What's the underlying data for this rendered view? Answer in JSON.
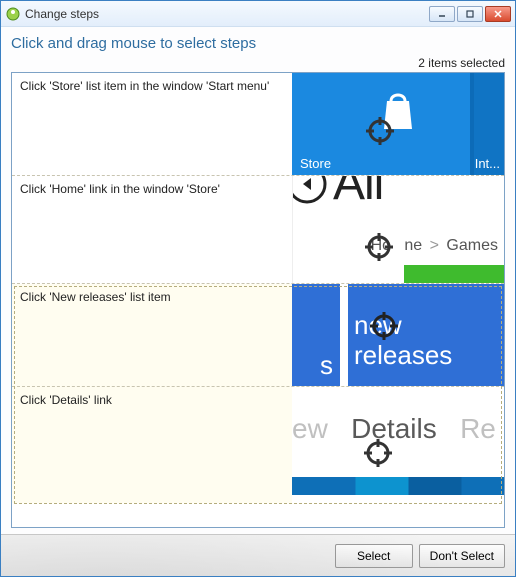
{
  "window": {
    "title": "Change steps"
  },
  "instruction": "Click and drag mouse to select steps",
  "selection_count_text": "2 items selected",
  "steps": [
    {
      "desc": "Click 'Store' list item in the window 'Start menu'",
      "selected": false,
      "thumb": {
        "store_label": "Store",
        "store_label2": "Int..."
      }
    },
    {
      "desc": "Click 'Home' link in the window 'Store'",
      "selected": false,
      "thumb": {
        "big_text": "All",
        "crumb_home": "Ho",
        "crumb_ne": "ne",
        "crumb_sep": ">",
        "crumb_games": "Games"
      }
    },
    {
      "desc": "Click 'New releases' list item",
      "selected": true,
      "thumb": {
        "tile_left_frag": "s",
        "tile_right_line1": "new",
        "tile_right_line2": "releases"
      }
    },
    {
      "desc": "Click 'Details' link",
      "selected": true,
      "thumb": {
        "left_frag": "ew",
        "mid": "Details",
        "right_frag": "Re"
      }
    }
  ],
  "buttons": {
    "select": "Select",
    "dont_select": "Don't Select"
  }
}
